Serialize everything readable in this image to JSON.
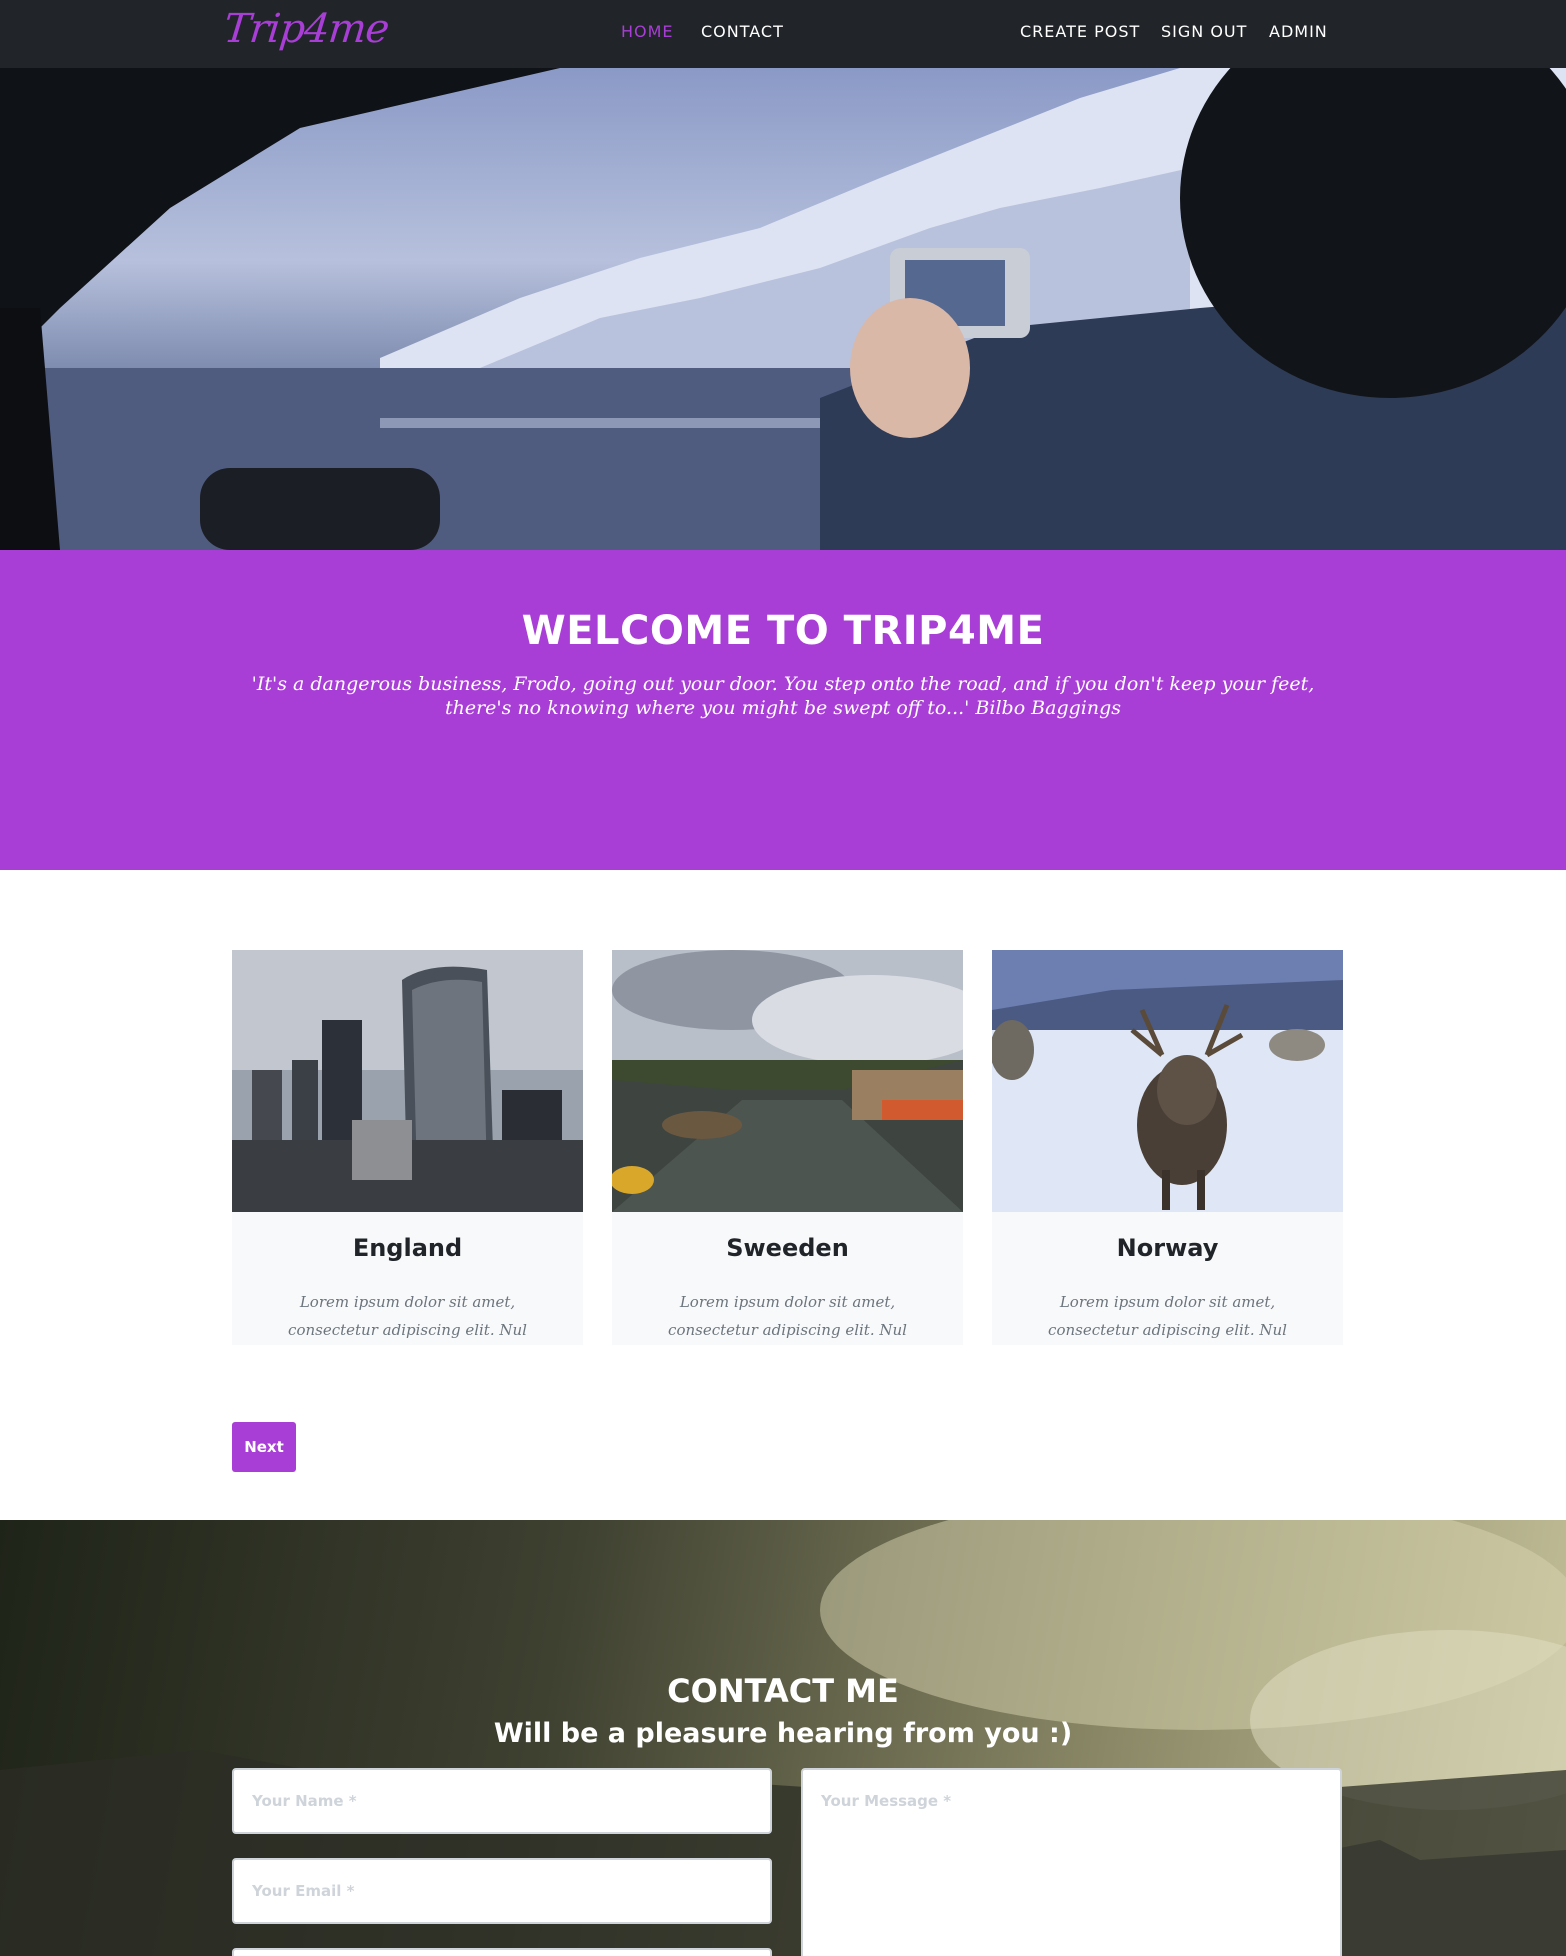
{
  "nav": {
    "logo": "Trip4me",
    "links": [
      {
        "label": "Home",
        "active": true
      },
      {
        "label": "Contact",
        "active": false
      }
    ],
    "right_links": [
      {
        "label": "Create Post"
      },
      {
        "label": "Sign Out"
      },
      {
        "label": "Admin"
      }
    ]
  },
  "welcome": {
    "title": "WELCOME TO TRIP4ME",
    "quote": "'It's a dangerous business, Frodo, going out your door. You step onto the road, and if you don't keep your feet, there's no knowing where you might be swept off to...' Bilbo Baggings"
  },
  "posts": [
    {
      "title": "England",
      "excerpt": "Lorem ipsum dolor sit amet, consectetur adipiscing elit. Nul"
    },
    {
      "title": "Sweeden",
      "excerpt": "Lorem ipsum dolor sit amet, consectetur adipiscing elit. Nul"
    },
    {
      "title": "Norway",
      "excerpt": "Lorem ipsum dolor sit amet, consectetur adipiscing elit. Nul"
    }
  ],
  "pagination": {
    "next_label": "Next"
  },
  "contact": {
    "title": "CONTACT ME",
    "subtitle": "Will be a pleasure hearing from you :)",
    "name_placeholder": "Your Name *",
    "email_placeholder": "Your Email *",
    "message_placeholder": "Your Message *"
  },
  "colors": {
    "accent": "#a83ed5",
    "nav_bg": "#212529",
    "card_bg": "#f8f9fa"
  }
}
